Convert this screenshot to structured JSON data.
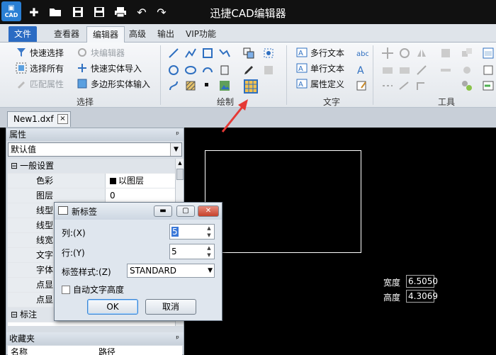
{
  "window": {
    "title": "迅捷CAD编辑器",
    "logo_text": "CAD"
  },
  "menu_tabs": [
    {
      "label": "文件"
    },
    {
      "label": "查看器"
    },
    {
      "label": "编辑器"
    },
    {
      "label": "高级"
    },
    {
      "label": "输出"
    },
    {
      "label": "VIP功能"
    }
  ],
  "ribbon": {
    "select_group": {
      "label": "选择",
      "quick_select": "快速选择",
      "select_all": "选择所有",
      "match_props": "匹配属性",
      "block_editor": "块编辑器",
      "quick_entity_import": "快速实体导入",
      "polygon_entity_input": "多边形实体输入"
    },
    "draw_group": {
      "label": "绘制"
    },
    "text_group": {
      "label": "文字",
      "mtext": "多行文本",
      "stext": "单行文本",
      "attdef": "属性定义"
    },
    "tools_group": {
      "label": "工具"
    }
  },
  "doc_tab": {
    "name": "New1.dxf",
    "close": "×"
  },
  "properties_panel": {
    "title": "属性",
    "pin": "ᵖ",
    "dropdown_value": "默认值",
    "rows": [
      {
        "key": "一般设置",
        "value": "",
        "group": true,
        "prefix": "⊟"
      },
      {
        "key": "色彩",
        "value": "以图层",
        "swatch": "#000000"
      },
      {
        "key": "图层",
        "value": "0"
      },
      {
        "key": "线型",
        "value": ""
      },
      {
        "key": "线型",
        "value": ""
      },
      {
        "key": "线宽",
        "value": ""
      },
      {
        "key": "文字",
        "value": ""
      },
      {
        "key": "字体",
        "value": ""
      },
      {
        "key": "点显",
        "value": ""
      },
      {
        "key": "点显",
        "value": ""
      },
      {
        "key": "标注",
        "value": "",
        "group": true,
        "prefix": "⊟"
      }
    ],
    "favorites_title": "收藏夹",
    "fav_col_name": "名称",
    "fav_col_path": "路径"
  },
  "canvas": {
    "width_label": "宽度",
    "width_value": "6.5050",
    "height_label": "高度",
    "height_value": "4.3069"
  },
  "dialog": {
    "title": "新标签",
    "columns_label": "列:(X)",
    "columns_value": "5",
    "rows_label": "行:(Y)",
    "rows_value": "5",
    "style_label": "标签样式:(Z)",
    "style_value": "STANDARD",
    "auto_height_label": "自动文字高度",
    "ok": "OK",
    "cancel": "取消"
  },
  "colors": {
    "accent": "#2b6bc3",
    "arrow": "#e53935"
  }
}
